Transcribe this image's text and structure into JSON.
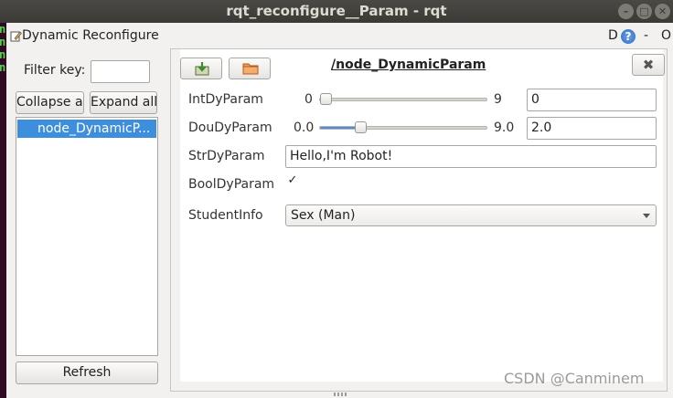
{
  "window": {
    "title": "rqt_reconfigure__Param - rqt",
    "buttons": [
      "–",
      "□",
      "✕"
    ]
  },
  "terminal_strip": {
    "chars": [
      "n",
      "n",
      "n",
      "n"
    ],
    "color": "#4fd34f"
  },
  "dock": {
    "title": "Dynamic Reconfigure",
    "d_label": "D",
    "help_label": "?",
    "minimize_label": "-",
    "close_label": "O"
  },
  "left": {
    "filter_label": "Filter key:",
    "filter_value": "",
    "collapse_label": "Collapse all",
    "expand_label": "Expand all",
    "tree_items": [
      "node_DynamicP..."
    ],
    "refresh_label": "Refresh"
  },
  "node": {
    "title": "/node_DynamicParam",
    "close_label": "✖",
    "params": {
      "int": {
        "label": "IntDyParam",
        "min": "0",
        "max": "9",
        "value": "0",
        "slider_fraction": 0.0
      },
      "double": {
        "label": "DouDyParam",
        "min": "0.0",
        "max": "9.0",
        "value": "2.0",
        "slider_fraction": 0.222
      },
      "str": {
        "label": "StrDyParam",
        "value": "Hello,I'm Robot!"
      },
      "bool": {
        "label": "BoolDyParam",
        "checked": true,
        "check_mark": "✓"
      },
      "enum": {
        "label": "StudentInfo",
        "value": "Sex (Man)"
      }
    }
  },
  "watermark": "CSDN @Canminem",
  "colors": {
    "accent": "#3e8ede",
    "slider_fill": "#4a90d9",
    "titlebar": "#3b3a36"
  }
}
